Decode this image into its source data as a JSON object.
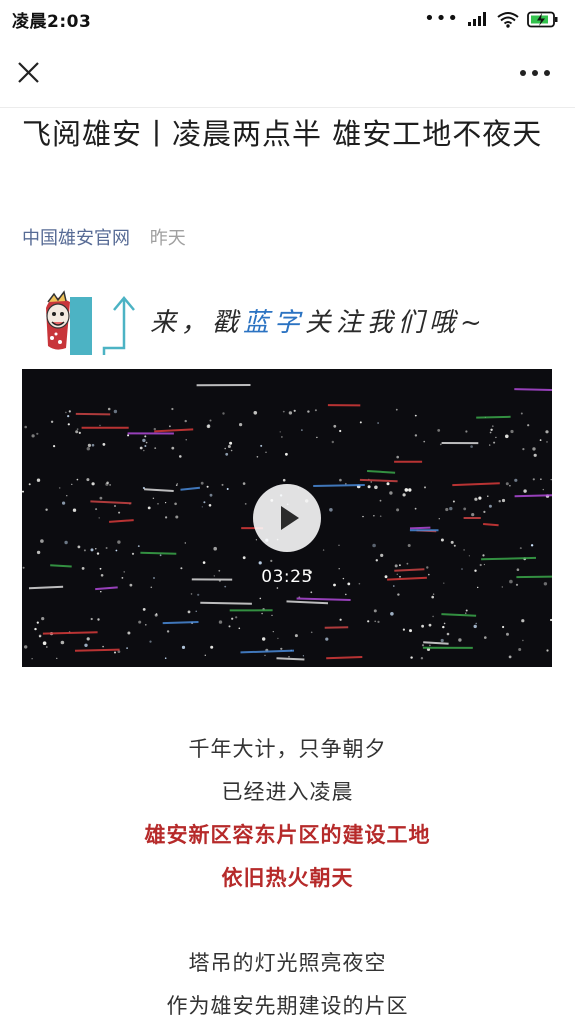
{
  "status_bar": {
    "time": "凌晨2:03",
    "icons": [
      "more-dots-icon",
      "signal-icon",
      "wifi-icon",
      "battery-charging-icon"
    ]
  },
  "nav": {
    "close_icon": "close-icon",
    "more_icon": "more-icon"
  },
  "article": {
    "title": "飞阅雄安丨凌晨两点半 雄安工地不夜天",
    "account": "中国雄安官网",
    "date": "昨天"
  },
  "follow_banner": {
    "prefix": "来，戳",
    "highlight": "蓝字",
    "suffix": "关注我们哦~",
    "highlight_color": "#2b73c2"
  },
  "video": {
    "duration": "03:25",
    "play_icon": "play-icon"
  },
  "body": {
    "lines_1": [
      "千年大计，只争朝夕",
      "已经进入凌晨"
    ],
    "lines_red": [
      "雄安新区容东片区的建设工地",
      "依旧热火朝天"
    ],
    "lines_2": [
      "塔吊的灯光照亮夜空",
      "作为雄安先期建设的片区"
    ],
    "red_color": "#b62a2a"
  }
}
